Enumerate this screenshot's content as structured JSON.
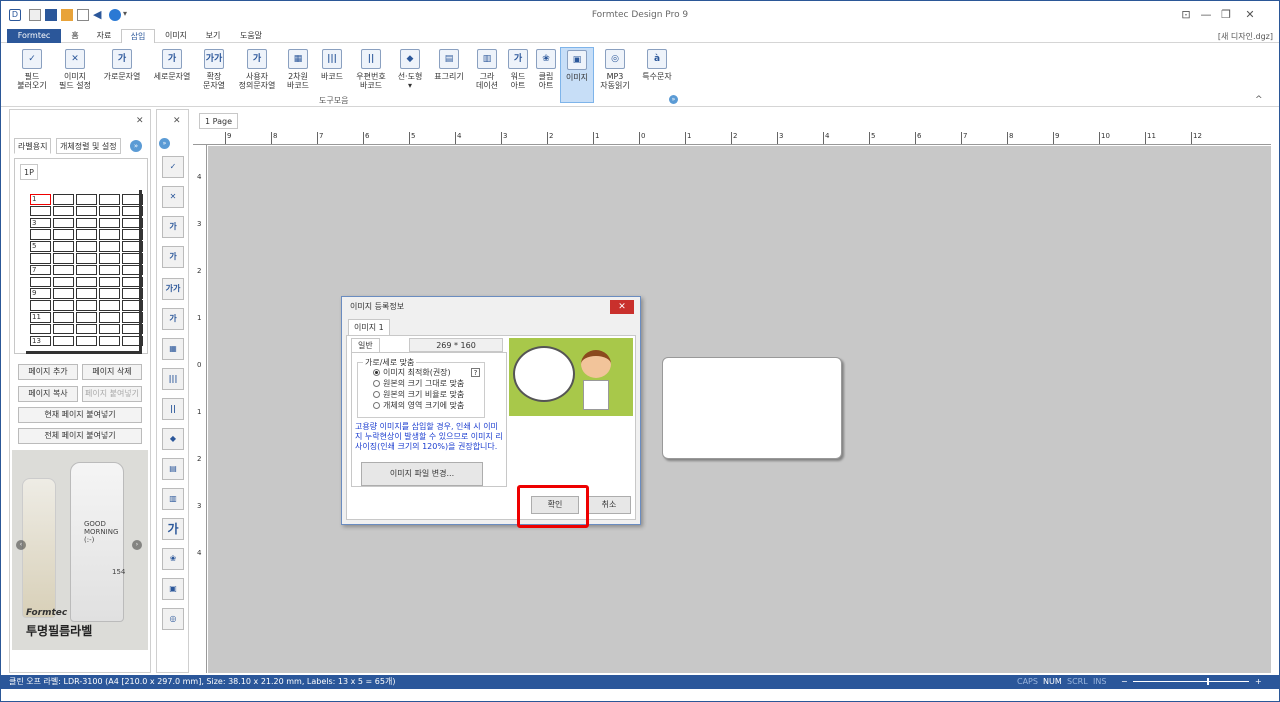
{
  "window": {
    "title": "Formtec Design Pro 9",
    "doc": "[새 디자인.dgz]"
  },
  "menu": [
    "Formtec",
    "홈",
    "자료",
    "삽입",
    "이미지",
    "보기",
    "도움말"
  ],
  "ribbon": {
    "items": [
      {
        "l1": "필드",
        "l2": "불러오기",
        "icon": "field-load-icon",
        "g": "✓"
      },
      {
        "l1": "이미지",
        "l2": "필드 설정",
        "icon": "image-field-icon",
        "g": "✕"
      },
      {
        "l1": "가로문자열",
        "l2": "",
        "icon": "horizontal-text-icon",
        "g": "가"
      },
      {
        "l1": "세로문자열",
        "l2": "",
        "icon": "vertical-text-icon",
        "g": "가"
      },
      {
        "l1": "확장",
        "l2": "문자열",
        "icon": "extended-text-icon",
        "g": "가가"
      },
      {
        "l1": "사용자",
        "l2": "정의문자열",
        "icon": "custom-text-icon",
        "g": "가"
      },
      {
        "l1": "2차원",
        "l2": "바코드",
        "icon": "qr-code-icon",
        "g": "▦"
      },
      {
        "l1": "바코드",
        "l2": "",
        "icon": "barcode-icon",
        "g": "|||"
      },
      {
        "l1": "우편번호",
        "l2": "바코드",
        "icon": "postal-barcode-icon",
        "g": "||"
      },
      {
        "l1": "선·도형",
        "l2": "▾",
        "icon": "shape-icon",
        "g": "◆"
      },
      {
        "l1": "표그리기",
        "l2": "",
        "icon": "table-icon",
        "g": "▤"
      },
      {
        "l1": "그라",
        "l2": "데이션",
        "icon": "gradient-icon",
        "g": "▥"
      },
      {
        "l1": "워드",
        "l2": "아트",
        "icon": "wordart-icon",
        "g": "가"
      },
      {
        "l1": "클립",
        "l2": "아트",
        "icon": "clipart-icon",
        "g": "❀"
      },
      {
        "l1": "이미지",
        "l2": "",
        "icon": "image-icon",
        "g": "▣"
      },
      {
        "l1": "MP3",
        "l2": "자동읽기",
        "icon": "mp3-icon",
        "g": "◎"
      },
      {
        "l1": "특수문자",
        "l2": "",
        "icon": "special-char-icon",
        "g": "à"
      }
    ],
    "group": "도구모음"
  },
  "left": {
    "tabs": [
      "라벨용지",
      "개체정렬 및 설정"
    ],
    "page_tab": "1P",
    "row_numbers": [
      "1",
      "3",
      "5",
      "7",
      "9",
      "11",
      "13"
    ],
    "buttons": [
      "페이지 추가",
      "페이지 삭제",
      "페이지 복사",
      "페이지 붙여넣기",
      "현재 페이지 붙여넣기",
      "전체 페이지 붙여넣기"
    ],
    "ad": {
      "brand": "Formtec",
      "title": "투명필름라벨",
      "bottle1": "GOOD",
      "bottle2": "MORNING",
      "bottle3": "(:-)",
      "num": "154"
    }
  },
  "canvas": {
    "page_tab": "1 Page",
    "hruler": [
      "9",
      "8",
      "7",
      "6",
      "5",
      "4",
      "3",
      "2",
      "1",
      "0",
      "1",
      "2",
      "3",
      "4",
      "5",
      "6",
      "7",
      "8",
      "9",
      "10",
      "11",
      "12"
    ],
    "vruler": [
      "4",
      "3",
      "2",
      "1",
      "0",
      "1",
      "2",
      "3",
      "4"
    ]
  },
  "dialog": {
    "title": "이미지 등록정보",
    "tab": "이미지 1",
    "subtab": "일반",
    "size": "269 * 160",
    "group": "가로/세로 맞춤",
    "help": "?",
    "options": [
      "이미지 최적화(권장)",
      "원본의 크기 그대로 맞춤",
      "원본의 크기 비율로 맞춤",
      "개체의 영역 크기에 맞춤"
    ],
    "warning": "고용량 이미지를 삽입할 경우, 인쇄 시 이미지 누락현상이 발생할 수 있으므로 이미지 리사이징(인쇄 크기의 120%)을 권장합니다.",
    "change_btn": "이미지 파일 변경...",
    "ok": "확인",
    "cancel": "취소"
  },
  "status": {
    "text": "클린 오프 라벨: LDR-3100 (A4 [210.0 x 297.0 mm], Size: 38.10 x 21.20 mm, Labels: 13 x 5 = 65개)",
    "caps": "CAPS",
    "num": "NUM",
    "scrl": "SCRL",
    "ins": "INS",
    "minus": "−",
    "plus": "+"
  }
}
